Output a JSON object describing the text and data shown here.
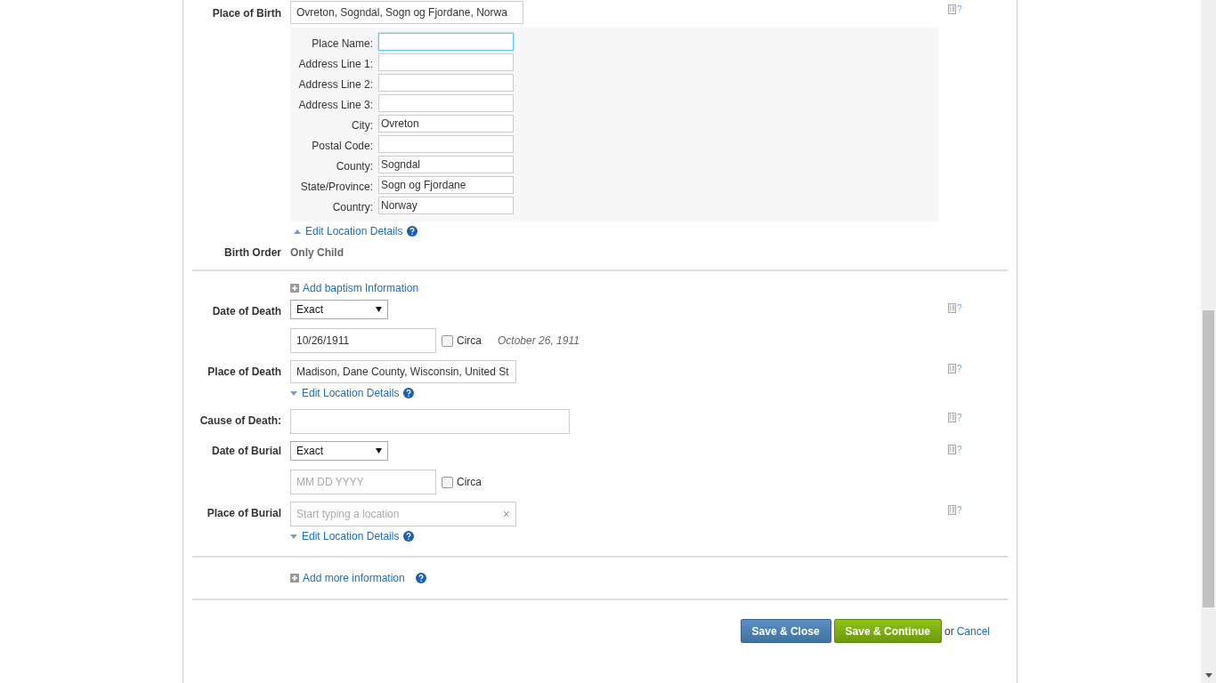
{
  "place_of_birth": {
    "label": "Place of Birth",
    "value": "Ovreton, Sogndal, Sogn og Fjordane, Norwa",
    "note": "?"
  },
  "location_details": {
    "expanded": true,
    "toggle": "Edit Location Details",
    "fields": [
      {
        "label": "Place Name:",
        "focused": true
      },
      {
        "label": "Address Line 1:",
        "focused": false
      },
      {
        "label": "Address Line 2:",
        "focused": false
      },
      {
        "label": "Address Line 3:",
        "focused": false
      },
      {
        "label": "City:",
        "value": "Ovreton",
        "focused": false
      },
      {
        "label": "Postal Code:",
        "focused": false
      },
      {
        "label": "County:",
        "value": "Sogndal",
        "focused": false
      },
      {
        "label": "State/Province:",
        "value": "Sogn og Fjordane",
        "focused": false
      },
      {
        "label": "Country:",
        "value": "Norway",
        "focused": false
      }
    ]
  },
  "birth_order": {
    "label": "Birth Order",
    "value": "Only Child"
  },
  "add_baptism": "Add baptism Information",
  "date_of_death": {
    "label": "Date of Death",
    "type": "Exact",
    "value": "10/26/1911",
    "circa": false,
    "circa_label": "Circa",
    "formatted": "October 26, 1911",
    "note": "?"
  },
  "place_of_death": {
    "label": "Place of Death",
    "value": "Madison, Dane County, Wisconsin, United St",
    "toggle": "Edit Location Details",
    "expanded": false,
    "note": "?"
  },
  "cause_of_death": {
    "label": "Cause of Death:",
    "note": "?"
  },
  "date_of_burial": {
    "label": "Date of Burial",
    "type": "Exact",
    "placeholder": "MM DD YYYY",
    "circa": false,
    "circa_label": "Circa",
    "note": "?"
  },
  "place_of_burial": {
    "label": "Place of Burial",
    "placeholder": "Start typing a location",
    "clear": "×",
    "toggle": "Edit Location Details",
    "expanded": false,
    "note": "?"
  },
  "add_more": "Add more information",
  "actions": {
    "save_close": "Save & Close",
    "save_continue": "Save & Continue",
    "or": "or",
    "cancel": "Cancel"
  }
}
